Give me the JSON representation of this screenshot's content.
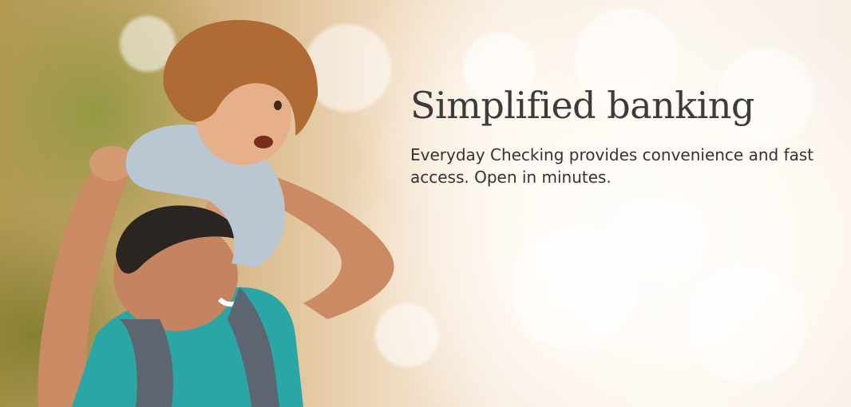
{
  "hero": {
    "headline": "Simplified banking",
    "subcopy": "Everyday Checking provides convenience and fast access. Open in minutes."
  },
  "image": {
    "description_icon": "family-photo-image"
  },
  "colors": {
    "headline_text": "#3b3b3b",
    "body_text": "#333333",
    "backdrop_warm": "#efd9bd"
  }
}
